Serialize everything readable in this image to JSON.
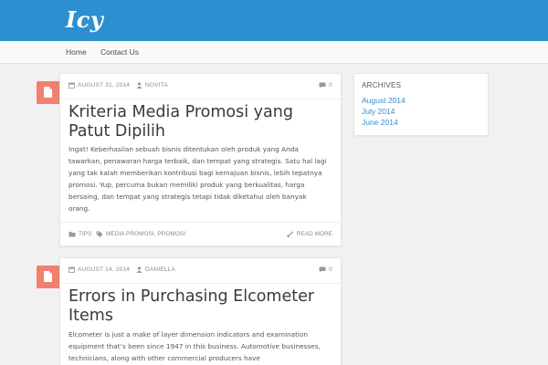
{
  "colors": {
    "brand": "#2e8fd0",
    "badge": "#f0806f",
    "background": "#f1f1f1"
  },
  "site": {
    "logo": "Icy"
  },
  "nav": {
    "items": [
      {
        "label": "Home"
      },
      {
        "label": "Contact Us"
      }
    ]
  },
  "posts": [
    {
      "badge_icon": "document-icon",
      "date": "AUGUST 31, 2014",
      "author": "NOVITA",
      "comments": "0",
      "title": "Kriteria Media Promosi yang Patut Dipilih",
      "excerpt": "Ingat! Keberhasilan sebuah bisnis ditentukan oleh produk yang Anda tawarkan, penawaran harga terbaik, dan tempat yang strategis. Satu hal lagi yang tak kalah memberikan kontribusi bagi kemajuan bisnis, lebih tepatnya promosi. Yup, percuma bukan memiliki produk yang berkualitas, harga bersaing, dan tempat yang strategis tetapi tidak diketahui oleh banyak orang.",
      "category": "TIPS",
      "tags": "MEDIA PROMOSI, PROMOSI",
      "read_more": "READ MORE"
    },
    {
      "badge_icon": "document-icon",
      "date": "AUGUST 14, 2014",
      "author": "DANIELLA",
      "comments": "0",
      "title": "Errors in Purchasing Elcometer Items",
      "excerpt": "Elcometer is just a make of layer dimension indicators and examination equipment that’s been since 1947 in this business. Automotive businesses, technicians, along with other commercial producers have"
    }
  ],
  "sidebar": {
    "archives": {
      "title": "ARCHIVES",
      "items": [
        {
          "label": "August 2014"
        },
        {
          "label": "July 2014"
        },
        {
          "label": "June 2014"
        }
      ]
    }
  }
}
